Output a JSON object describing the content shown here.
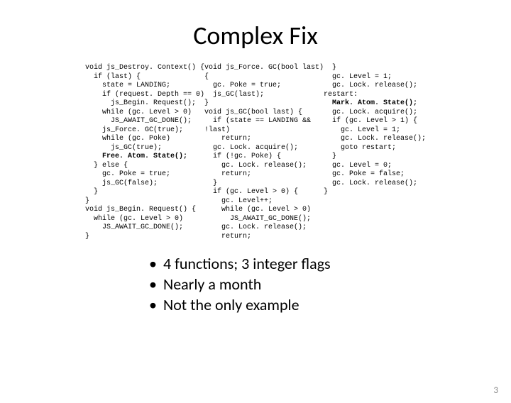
{
  "title": "Complex Fix",
  "code": {
    "col1": "void js_Destroy. Context() {\n  if (last) {\n    state = LANDING;\n    if (request. Depth == 0)\n      js_Begin. Request();\n    while (gc. Level > 0)\n      JS_AWAIT_GC_DONE();\n    js_Force. GC(true);\n    while (gc. Poke)\n      js_GC(true);\n    ",
    "col1_bold": "Free. Atom. State();",
    "col1b": "\n  } else {\n    gc. Poke = true;\n    js_GC(false);\n  }\n}\nvoid js_Begin. Request() {\n  while (gc. Level > 0)\n    JS_AWAIT_GC_DONE();\n}",
    "col2": "void js_Force. GC(bool last)\n{\n  gc. Poke = true;\n  js_GC(last);\n}\nvoid js_GC(bool last) {\n  if (state == LANDING &&\n!last)\n    return;\n  gc. Lock. acquire();\n  if (!gc. Poke) {\n    gc. Lock. release();\n    return;\n  }\n  if (gc. Level > 0) {\n    gc. Level++;\n    while (gc. Level > 0)\n      JS_AWAIT_GC_DONE();\n    gc. Lock. release();\n    return;",
    "col3": "  }\n  gc. Level = 1;\n  gc. Lock. release();\nrestart:\n  ",
    "col3_bold": "Mark. Atom. State();",
    "col3b": "\n  gc. Lock. acquire();\n  if (gc. Level > 1) {\n    gc. Level = 1;\n    gc. Lock. release();\n    goto restart;\n  }\n  gc. Level = 0;\n  gc. Poke = false;\n  gc. Lock. release();\n}"
  },
  "bullets": [
    "4 functions; 3 integer flags",
    "Nearly a month",
    "Not the only example"
  ],
  "page_number": "3"
}
